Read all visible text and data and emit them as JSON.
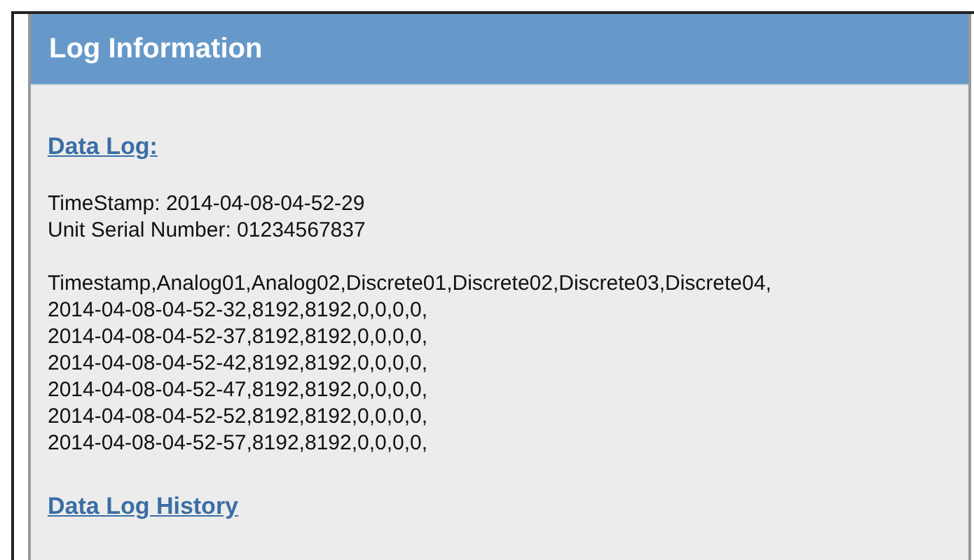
{
  "panel": {
    "title": "Log Information"
  },
  "data_log": {
    "heading": "Data Log:",
    "timestamp": "TimeStamp: 2014-04-08-04-52-29",
    "serial": "Unit Serial Number: 01234567837",
    "lines": [
      "Timestamp,Analog01,Analog02,Discrete01,Discrete02,Discrete03,Discrete04,",
      "2014-04-08-04-52-32,8192,8192,0,0,0,0,",
      "2014-04-08-04-52-37,8192,8192,0,0,0,0,",
      "2014-04-08-04-52-42,8192,8192,0,0,0,0,",
      "2014-04-08-04-52-47,8192,8192,0,0,0,0,",
      "2014-04-08-04-52-52,8192,8192,0,0,0,0,",
      "2014-04-08-04-52-57,8192,8192,0,0,0,0,"
    ]
  },
  "history_link": "Data Log History"
}
